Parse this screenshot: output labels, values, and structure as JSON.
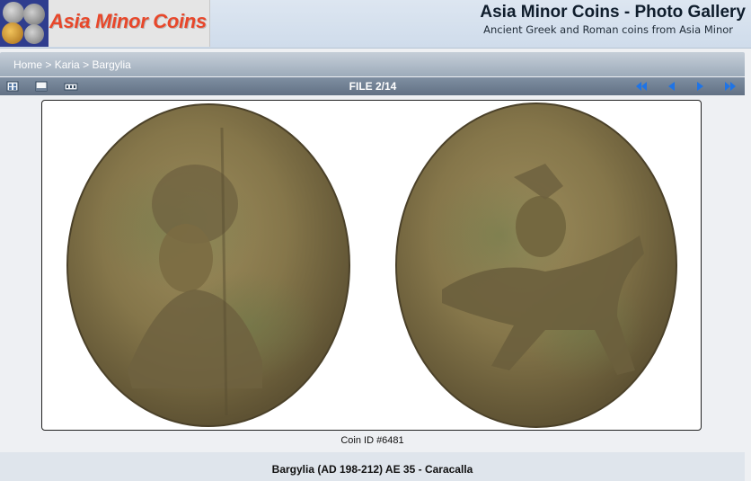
{
  "header": {
    "logo_text": "Asia Minor Coins",
    "title": "Asia Minor Coins - Photo Gallery",
    "subtitle": "Ancient Greek and Roman coins from Asia Minor"
  },
  "breadcrumb": [
    "Home",
    "Karia",
    "Bargylia"
  ],
  "breadcrumb_separator": ">",
  "toolbar": {
    "icons": [
      "thumbnails-icon",
      "slideshow-icon",
      "info-icon"
    ],
    "file_counter": "FILE 2/14",
    "nav": [
      "first-icon",
      "previous-icon",
      "next-icon",
      "last-icon"
    ]
  },
  "photo": {
    "caption": "Coin ID #6481",
    "coins": [
      "obverse-portrait",
      "reverse-rider"
    ]
  },
  "description": {
    "title": "Bargylia (AD 198-212) AE 35 - Caracalla"
  },
  "colors": {
    "header_bg": "#d6e1ee",
    "breadcrumb_bg": "#aab6c4",
    "toolbar_bg": "#6f7e91",
    "nav_arrow": "#1f74e6",
    "logo_text": "#e8472a",
    "coin_base": "#8a7a4e"
  }
}
